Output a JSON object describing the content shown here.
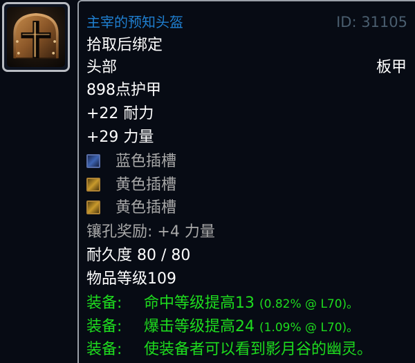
{
  "item": {
    "name": "主宰的预知头盔",
    "id_text": "ID: 31105",
    "binding": "拾取后绑定",
    "slot": "头部",
    "armor_type": "板甲",
    "armor": "898点护甲",
    "stats": [
      "+22 耐力",
      "+29 力量"
    ],
    "sockets": [
      {
        "color": "blue",
        "label": "蓝色插槽"
      },
      {
        "color": "yellow",
        "label": "黄色插槽"
      },
      {
        "color": "yellow",
        "label": "黄色插槽"
      }
    ],
    "socket_bonus": "镶孔奖励: +4 力量",
    "durability": "耐久度 80 / 80",
    "item_level": "物品等级109",
    "equip_effects": [
      {
        "prefix": "装备:",
        "text": "命中等级提高13",
        "detail": "(0.82% @ L70)。"
      },
      {
        "prefix": "装备:",
        "text": "爆击等级提高24",
        "detail": "(1.09% @ L70)。"
      },
      {
        "prefix": "装备:",
        "text": "使装备者可以看到影月谷的幽灵。",
        "detail": ""
      }
    ]
  },
  "colors": {
    "name": "#1f7fd0",
    "id": "#4a5e6f",
    "text": "#ffffff",
    "muted": "#a8a8a8",
    "equip": "#1edc1e",
    "background": "#070b14"
  },
  "icon": {
    "name": "plate-helm-icon"
  }
}
